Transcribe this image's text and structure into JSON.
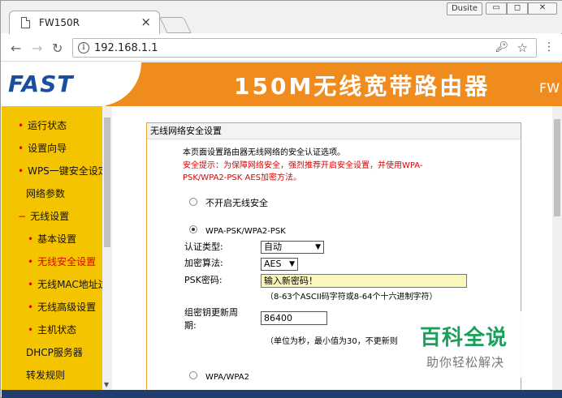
{
  "browser": {
    "tab_title": "FW150R",
    "tab_close": "×",
    "user": "Dusite",
    "url": "192.168.1.1"
  },
  "banner": {
    "logo": "FAST",
    "title": "150M无线宽带路由器",
    "model": "FW"
  },
  "sidebar": {
    "items": [
      {
        "label": "运行状态",
        "dot": true,
        "active": false
      },
      {
        "label": "设置向导",
        "dot": true,
        "active": false
      },
      {
        "label": "WPS一键安全设定",
        "dot": true,
        "active": false
      },
      {
        "label": "网络参数",
        "dot": false,
        "active": false
      },
      {
        "label": "无线设置",
        "dot": true,
        "active": false
      },
      {
        "label": "基本设置",
        "dot": true,
        "active": false
      },
      {
        "label": "无线安全设置",
        "dot": true,
        "active": true
      },
      {
        "label": "无线MAC地址过滤",
        "dot": true,
        "active": false
      },
      {
        "label": "无线高级设置",
        "dot": true,
        "active": false
      },
      {
        "label": "主机状态",
        "dot": true,
        "active": false
      },
      {
        "label": "DHCP服务器",
        "dot": false,
        "active": false
      },
      {
        "label": "转发规则",
        "dot": false,
        "active": false
      }
    ],
    "dot_glyph": "•",
    "dash_glyph": "−"
  },
  "panel": {
    "heading": "无线网络安全设置",
    "intro": "本页面设置路由器无线网络的安全认证选项。",
    "warning_line1": "安全提示：为保障网络安全，强烈推荐开启安全设置，并使用WPA-",
    "warning_line2": "PSK/WPA2-PSK AES加密方法。",
    "opt_none": "不开启无线安全",
    "opt_wpa_psk": "WPA-PSK/WPA2-PSK",
    "auth_label": "认证类型:",
    "auth_value": "自动",
    "enc_label": "加密算法:",
    "enc_value": "AES",
    "psk_label": "PSK密码:",
    "psk_value": "输入新密码！",
    "psk_hint": "（8-63个ASCII码字符或8-64个十六进制字符）",
    "renew_label_1": "组密钥更新周",
    "renew_label_2": "期:",
    "renew_value": "86400",
    "renew_hint": "（单位为秒，最小值为30，不更新则",
    "opt_wpa": "WPA/WPA2"
  },
  "watermark": {
    "title": "百科全说",
    "subtitle": "助你轻松解决"
  }
}
